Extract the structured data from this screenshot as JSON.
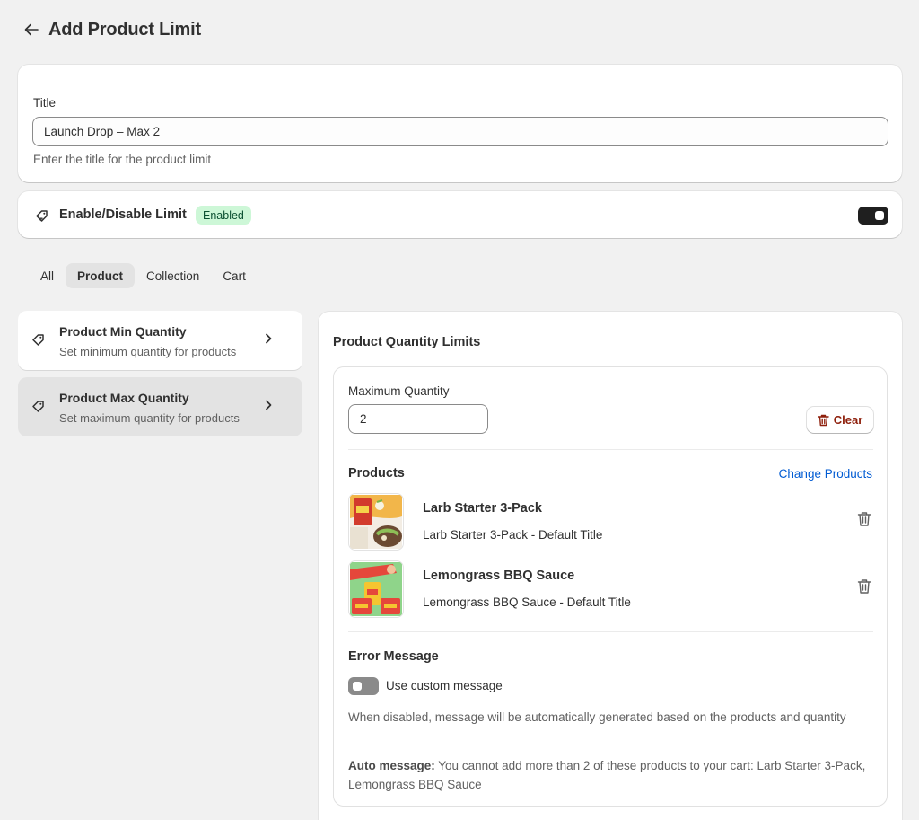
{
  "header": {
    "title": "Add Product Limit",
    "back_icon": "arrow-left-icon"
  },
  "title_section": {
    "label": "Title",
    "value": "Launch Drop – Max 2",
    "help": "Enter the title for the product limit"
  },
  "enable_section": {
    "label": "Enable/Disable Limit",
    "badge": "Enabled",
    "enabled": true,
    "icon": "tag-icon"
  },
  "tabs": [
    {
      "label": "All",
      "active": false
    },
    {
      "label": "Product",
      "active": true
    },
    {
      "label": "Collection",
      "active": false
    },
    {
      "label": "Cart",
      "active": false
    }
  ],
  "rules": [
    {
      "title": "Product Min Quantity",
      "description": "Set minimum quantity for products",
      "selected": false
    },
    {
      "title": "Product Max Quantity",
      "description": "Set maximum quantity for products",
      "selected": true
    }
  ],
  "limits": {
    "title": "Product Quantity Limits",
    "max_label": "Maximum Quantity",
    "max_value": "2",
    "clear_label": "Clear",
    "products_title": "Products",
    "change_products_label": "Change Products",
    "products": [
      {
        "name": "Larb Starter 3-Pack",
        "variant": "Larb Starter 3-Pack - Default Title"
      },
      {
        "name": "Lemongrass BBQ Sauce",
        "variant": "Lemongrass BBQ Sauce - Default Title"
      }
    ],
    "error": {
      "title": "Error Message",
      "toggle_label": "Use custom message",
      "custom_enabled": false,
      "help": "When disabled, message will be automatically generated based on the products and quantity",
      "auto_label": "Auto message:",
      "auto_text": " You cannot add more than 2 of these products to your cart: Larb Starter 3-Pack, Lemongrass BBQ Sauce"
    }
  },
  "colors": {
    "background": "#f1f1f1",
    "card": "#ffffff",
    "badge_bg": "#cdf7d7",
    "badge_text": "#0c5132",
    "link": "#005bd3",
    "danger": "#8e1f0b",
    "toggle_on": "#1f1f1f",
    "toggle_off": "#8a8a8a"
  }
}
